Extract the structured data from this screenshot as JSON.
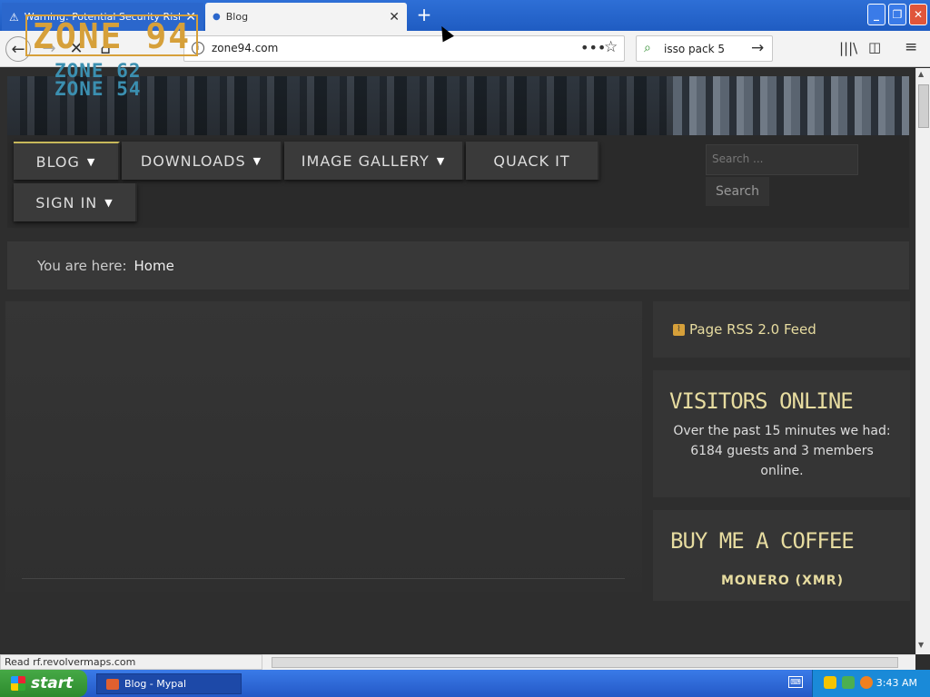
{
  "browser": {
    "tabs": [
      {
        "label": "Warning: Potential Security Risk A",
        "close": "✕"
      },
      {
        "label": "Blog",
        "close": "✕"
      }
    ],
    "new_tab": "+",
    "url": "zone94.com",
    "search_query": "isso pack 5",
    "status_text": "Read rf.revolvermaps.com"
  },
  "site": {
    "logo": {
      "main": "ZONE 94",
      "sub1": "ZONE 62",
      "sub2": "ZONE 54"
    },
    "menu": [
      {
        "label": "BLOG",
        "dropdown": true
      },
      {
        "label": "DOWNLOADS",
        "dropdown": true
      },
      {
        "label": "IMAGE GALLERY",
        "dropdown": true
      },
      {
        "label": "QUACK IT",
        "dropdown": false
      },
      {
        "label": "SIGN IN",
        "dropdown": true
      }
    ],
    "search": {
      "placeholder": "Search ...",
      "button": "Search"
    },
    "breadcrumb": {
      "prefix": "You are here:",
      "current": "Home"
    },
    "sidebar": {
      "rss": "Page RSS 2.0 Feed",
      "visitors_title": "VISITORS ONLINE",
      "visitors_text": "Over the past 15 minutes we had: 6184 guests and 3 members online.",
      "coffee_title": "BUY ME A COFFEE",
      "coffee_sub": "MONERO (XMR)"
    },
    "accent_color": "#e7dca0"
  },
  "taskbar": {
    "start": "start",
    "items": [
      "Blog - Mypal"
    ],
    "clock": "3:43 AM"
  }
}
